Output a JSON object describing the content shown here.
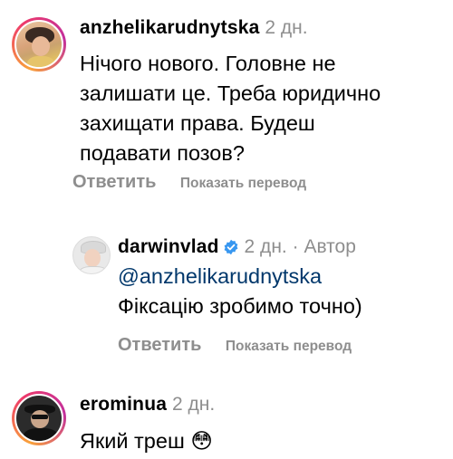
{
  "comments": [
    {
      "username": "anzhelikarudnytska",
      "time": "2 дн.",
      "lines": [
        "Нічого нового. Головне не",
        "залишати це. Треба юридично",
        "захищати права. Будеш",
        "подавати позов?"
      ],
      "reply_label": "Ответить",
      "translate_label": "Показать перевод"
    },
    {
      "username": "darwinvlad",
      "time": "2 дн.",
      "separator": "·",
      "author_label": "Автор",
      "mention": "@anzhelikarudnytska",
      "line": "Фіксацію зробимо точно)",
      "reply_label": "Ответить",
      "translate_label": "Показать перевод"
    },
    {
      "username": "erominua",
      "time": "2 дн.",
      "line": "Який треш 😳"
    }
  ],
  "colors": {
    "secondary_text": "#8e8e8e",
    "mention": "#00376b",
    "verified_badge": "#3897f0"
  }
}
